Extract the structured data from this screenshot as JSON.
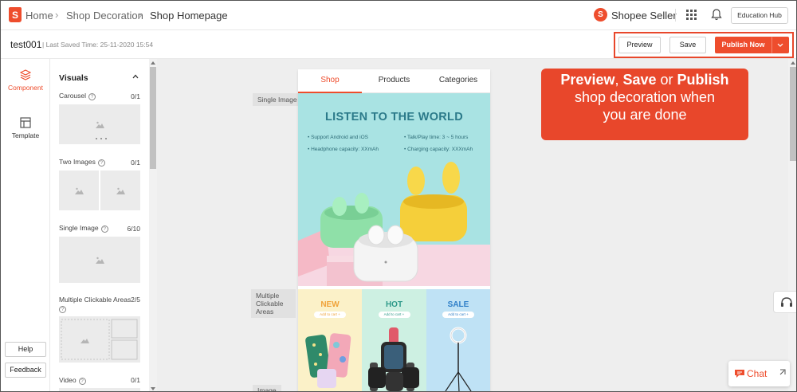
{
  "header": {
    "breadcrumb": [
      "Home",
      "Shop Decoration",
      "Shop Homepage"
    ],
    "seller_label": "Shopee Seller",
    "education_hub": "Education Hub"
  },
  "subbar": {
    "shop_name": "test001",
    "saved_time": "Last Saved Time: 25-11-2020 15:54",
    "preview": "Preview",
    "save": "Save",
    "publish": "Publish Now"
  },
  "rail": {
    "component": "Component",
    "template": "Template",
    "help": "Help",
    "feedback": "Feedback"
  },
  "panel": {
    "title": "Visuals",
    "components": [
      {
        "label": "Carousel",
        "count": "0/1"
      },
      {
        "label": "Two Images",
        "count": "0/1"
      },
      {
        "label": "Single Image",
        "count": "6/10"
      },
      {
        "label": "Multiple Clickable Areas",
        "count": "2/5"
      },
      {
        "label": "Video",
        "count": "0/1"
      }
    ]
  },
  "canvas": {
    "tags": [
      "Single Image",
      "Multiple Clickable Areas",
      "Image"
    ],
    "tabs": [
      "Shop",
      "Products",
      "Categories"
    ],
    "banner": {
      "title": "LISTEN TO THE WORLD",
      "bullets": [
        "Support Android and iOS",
        "Talk/Play time: 3 ~ 5 hours",
        "Headphone capacity: XXmAh",
        "Charging capacity: XXXmAh"
      ]
    },
    "promos": [
      {
        "title": "NEW",
        "button": "Add to cart +",
        "color": "#f0a33a"
      },
      {
        "title": "HOT",
        "button": "Add to cart +",
        "color": "#2f9a8a"
      },
      {
        "title": "SALE",
        "button": "Add to cart +",
        "color": "#2f7fc8"
      }
    ]
  },
  "callout": {
    "line1_a": "Preview",
    "line1_sep1": ", ",
    "line1_b": "Save",
    "line1_sep2": " or ",
    "line1_c": "Publish",
    "line2": "shop decoration when",
    "line3": "you are done"
  },
  "chat": {
    "label": "Chat"
  },
  "colors": {
    "brand": "#ee4d2d",
    "callout": "#e8472b",
    "banner_bg": "#a9e3e3"
  }
}
